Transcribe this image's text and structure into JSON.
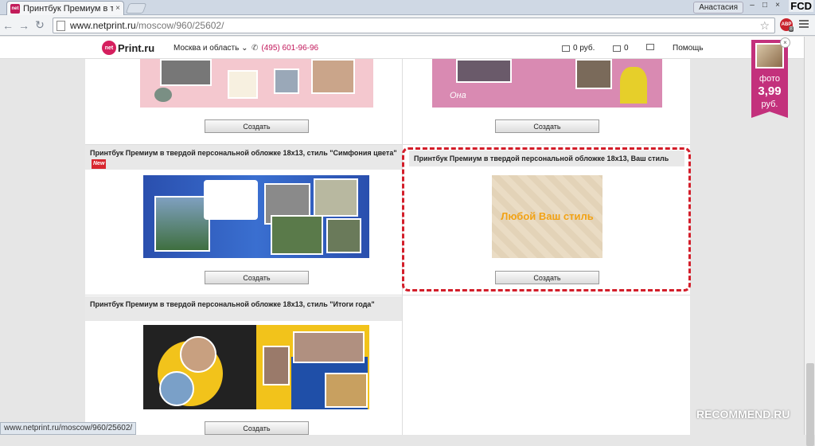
{
  "browser": {
    "tab_title": "Принтбук Премиум в тве",
    "tab_close": "×",
    "favicon_text": "net",
    "user_name": "Анастасия",
    "window_controls": [
      "–",
      "□",
      "×"
    ],
    "corner_tag": "FCD",
    "url_host": "www.netprint.ru",
    "url_path": "/moscow/960/25602/",
    "abp_label": "ABP",
    "abp_count": "8",
    "status_url": "www.netprint.ru/moscow/960/25602/"
  },
  "header": {
    "logo_mark": "net",
    "logo_text": "Print.ru",
    "region": "Москва и область ⌄",
    "phone": "(495) 601-96-96",
    "balance": "0 руб.",
    "cart_count": "0",
    "help": "Помощь"
  },
  "promo": {
    "label": "фото",
    "price": "3,99",
    "unit": "руб."
  },
  "products": [
    {
      "title": "",
      "button": "Создать"
    },
    {
      "title": "",
      "button": "Создать"
    },
    {
      "title": "Принтбук Премиум в твердой персональной обложке 18х13, стиль \"Симфония цвета\"",
      "badge": "New",
      "button": "Создать"
    },
    {
      "title": "Принтбук Премиум в твердой персональной обложке 18х13, Ваш стиль",
      "placeholder": "Любой Ваш стиль",
      "button": "Создать"
    },
    {
      "title": "Принтбук Премиум в твердой персональной обложке 18х13, стиль \"Итоги года\"",
      "button": "Создать"
    }
  ],
  "image_text": {
    "magenta_caption": "Она"
  },
  "watermark": "RECOMMEND.RU"
}
